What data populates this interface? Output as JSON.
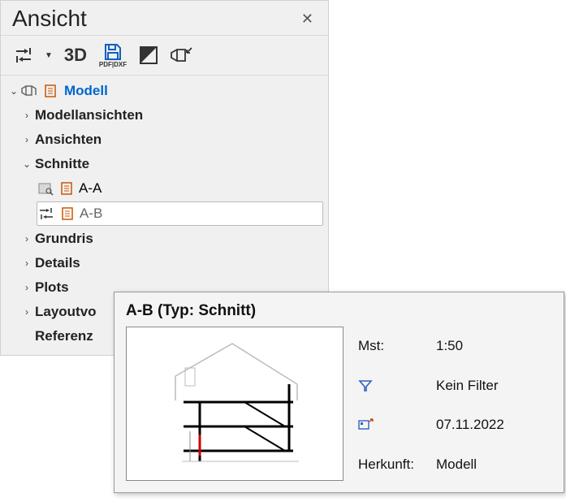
{
  "panel": {
    "title": "Ansicht",
    "toolbar": {
      "three_d": "3D",
      "export_caption": "PDF|DXF"
    }
  },
  "tree": {
    "root": "Modell",
    "nodes": [
      {
        "label": "Modellansichten",
        "expanded": false
      },
      {
        "label": "Ansichten",
        "expanded": false
      },
      {
        "label": "Schnitte",
        "expanded": true,
        "children": [
          {
            "label": "A-A"
          },
          {
            "label": "A-B",
            "selected": true
          }
        ]
      },
      {
        "label": "Grundris",
        "expanded": false
      },
      {
        "label": "Details",
        "expanded": false
      },
      {
        "label": "Plots",
        "expanded": false
      },
      {
        "label": "Layoutvo",
        "expanded": false
      },
      {
        "label": "Referenz",
        "expanded": false,
        "no_expander": true
      }
    ]
  },
  "tooltip": {
    "title": "A-B  (Typ: Schnitt)",
    "rows": {
      "scale_label": "Mst:",
      "scale_value": "1:50",
      "filter_value": "Kein Filter",
      "date_value": "07.11.2022",
      "origin_label": "Herkunft:",
      "origin_value": "Modell"
    }
  }
}
